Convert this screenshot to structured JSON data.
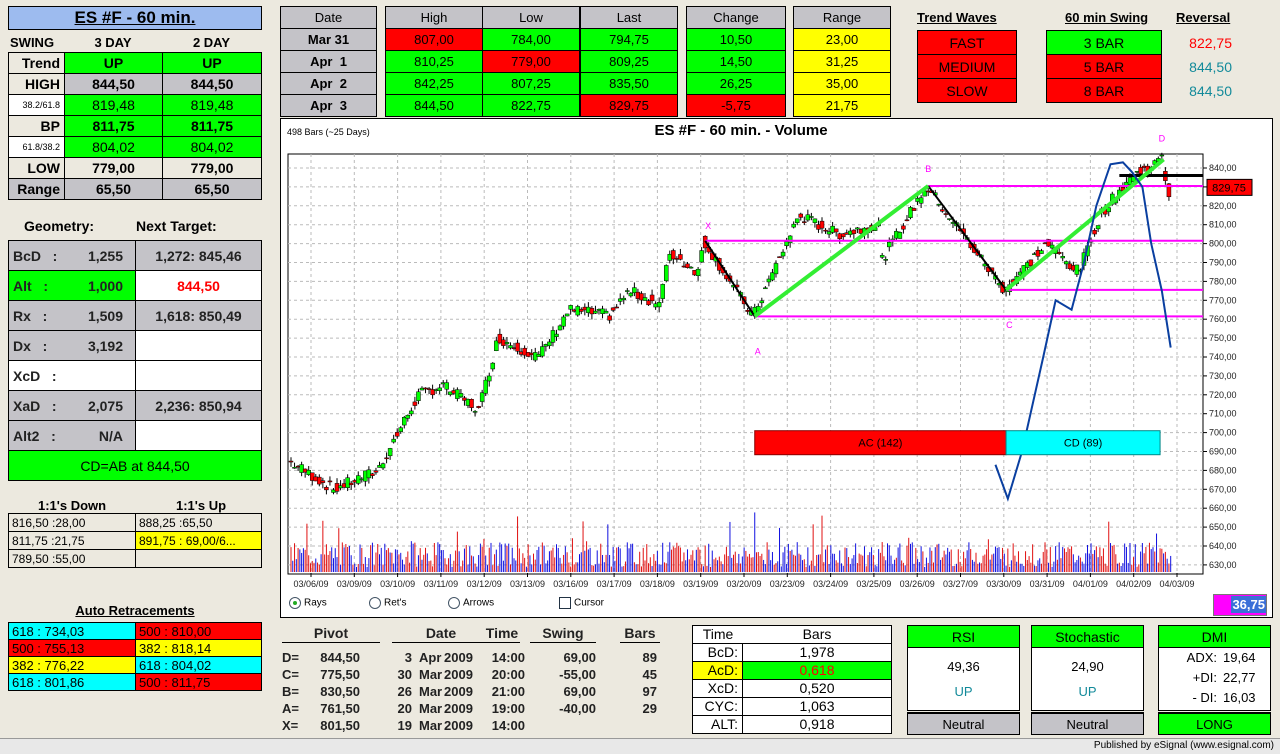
{
  "title": "ES #F - 60 min.",
  "swing": {
    "label": "SWING",
    "col1": "3 DAY",
    "col2": "2 DAY",
    "rows": [
      {
        "label": "Trend",
        "v1": "UP",
        "v2": "UP",
        "cls": "g",
        "lcls": "bg",
        "bold": true
      },
      {
        "label": "HIGH",
        "v1": "844,50",
        "v2": "844,50",
        "cls": "gr",
        "lcls": "bg",
        "bold": true
      },
      {
        "label": "38.2/61.8",
        "v1": "819,48",
        "v2": "819,48",
        "cls": "g",
        "lcls": "w",
        "small": true
      },
      {
        "label": "BP",
        "v1": "811,75",
        "v2": "811,75",
        "cls": "g",
        "lcls": "bg",
        "bold": true
      },
      {
        "label": "61.8/38.2",
        "v1": "804,02",
        "v2": "804,02",
        "cls": "g",
        "lcls": "w",
        "small": true
      },
      {
        "label": "LOW",
        "v1": "779,00",
        "v2": "779,00",
        "cls": "bg",
        "lcls": "bg",
        "bold": true
      },
      {
        "label": "Range",
        "v1": "65,50",
        "v2": "65,50",
        "cls": "gr",
        "lcls": "gr",
        "bold": true
      }
    ]
  },
  "geometry": {
    "h1": "Geometry:",
    "h2": "Next Target:",
    "rows": [
      {
        "label": "BcD",
        "val": "1,255",
        "target": "1,272: 845,46",
        "cls": "gr",
        "tcls": "gr"
      },
      {
        "label": "Alt",
        "val": "1,000",
        "target": "844,50",
        "cls": "g",
        "tcls": "w",
        "tred": true
      },
      {
        "label": "Rx",
        "val": "1,509",
        "target": "1,618: 850,49",
        "cls": "gr",
        "tcls": "gr"
      },
      {
        "label": "Dx",
        "val": "3,192",
        "target": "",
        "cls": "gr",
        "tcls": "w"
      },
      {
        "label": "XcD",
        "val": "",
        "target": "",
        "cls": "w",
        "tcls": "w"
      },
      {
        "label": "XaD",
        "val": "2,075",
        "target": "2,236: 850,94",
        "cls": "gr",
        "tcls": "gr"
      },
      {
        "label": "Alt2",
        "val": "N/A",
        "target": "",
        "cls": "gr",
        "tcls": "w"
      }
    ],
    "summary": "CD=AB at 844,50"
  },
  "ones": {
    "down_label": "1:1's Down",
    "up_label": "1:1's Up",
    "rows": [
      {
        "d": "816,50 :28,00",
        "u": "888,25 :65,50",
        "ucls": "bg"
      },
      {
        "d": "811,75 :21,75",
        "u": "891,75 : 69,00/6...",
        "ucls": "y"
      },
      {
        "d": "789,50 :55,00",
        "u": "",
        "ucls": "bg"
      }
    ]
  },
  "retr": {
    "label": "Auto Retracements",
    "rows": [
      {
        "l": "618 : 734,03",
        "lc": "cy",
        "r": "500 : 810,00",
        "rc": "r"
      },
      {
        "l": "500 : 755,13",
        "lc": "r",
        "r": "382 : 818,14",
        "rc": "y"
      },
      {
        "l": "382 : 776,22",
        "lc": "y",
        "r": "618 : 804,02",
        "rc": "cy"
      },
      {
        "l": "618 : 801,86",
        "lc": "cy",
        "r": "500 : 811,75",
        "rc": "r"
      }
    ]
  },
  "quotes": {
    "headers": [
      "Date",
      "High",
      "Low",
      "Last",
      "Change",
      "Range"
    ],
    "rows": [
      {
        "date": "Mar 31",
        "high": "807,00",
        "low": "784,00",
        "last": "794,75",
        "change": "10,50",
        "range": "23,00",
        "c": [
          "r",
          "g",
          "g",
          "g",
          "y"
        ]
      },
      {
        "date": "Apr  1",
        "high": "810,25",
        "low": "779,00",
        "last": "809,25",
        "change": "14,50",
        "range": "31,25",
        "c": [
          "g",
          "r",
          "g",
          "g",
          "y"
        ]
      },
      {
        "date": "Apr  2",
        "high": "842,25",
        "low": "807,25",
        "last": "835,50",
        "change": "26,25",
        "range": "35,00",
        "c": [
          "g",
          "g",
          "g",
          "g",
          "y"
        ]
      },
      {
        "date": "Apr  3",
        "high": "844,50",
        "low": "822,75",
        "last": "829,75",
        "change": "-5,75",
        "range": "21,75",
        "c": [
          "g",
          "g",
          "r",
          "r",
          "y"
        ]
      }
    ]
  },
  "trend": {
    "h1": "Trend Waves",
    "h2": "60 min Swing",
    "h3": "Reversal",
    "rows": [
      {
        "wave": "FAST",
        "swing": "3 BAR",
        "rev": "822,75",
        "sc": "g",
        "revc": "#ff0000"
      },
      {
        "wave": "MEDIUM",
        "swing": "5 BAR",
        "rev": "844,50",
        "sc": "r",
        "revc": "#128a9a"
      },
      {
        "wave": "SLOW",
        "swing": "8 BAR",
        "rev": "844,50",
        "sc": "r",
        "revc": "#128a9a"
      }
    ]
  },
  "chart_data": {
    "type": "candlestick",
    "title": "ES #F - 60 min. - Volume",
    "bars_label": "498 Bars (~25 Days)",
    "bars": 498,
    "ylim": [
      630,
      840
    ],
    "yticks": [
      "630,00",
      "640,00",
      "650,00",
      "660,00",
      "670,00",
      "680,00",
      "690,00",
      "700,00",
      "710,00",
      "720,00",
      "730,00",
      "740,00",
      "750,00",
      "760,00",
      "770,00",
      "780,00",
      "790,00",
      "800,00",
      "810,00",
      "820,00",
      "830,00",
      "840,00"
    ],
    "xticks": [
      "03/06/09",
      "03/09/09",
      "03/10/09",
      "03/11/09",
      "03/12/09",
      "03/13/09",
      "03/16/09",
      "03/17/09",
      "03/18/09",
      "03/19/09",
      "03/20/09",
      "03/23/09",
      "03/24/09",
      "03/25/09",
      "03/26/09",
      "03/27/09",
      "03/30/09",
      "03/31/09",
      "04/01/09",
      "04/02/09",
      "04/03/09"
    ],
    "path": [
      [
        0,
        685
      ],
      [
        25,
        670
      ],
      [
        50,
        680
      ],
      [
        73,
        720
      ],
      [
        87,
        725
      ],
      [
        107,
        712
      ],
      [
        118,
        750
      ],
      [
        141,
        740
      ],
      [
        158,
        765
      ],
      [
        181,
        762
      ],
      [
        192,
        775
      ],
      [
        209,
        768
      ],
      [
        215,
        795
      ],
      [
        231,
        785
      ],
      [
        234,
        801.5
      ],
      [
        262,
        761.5
      ],
      [
        288,
        815
      ],
      [
        310,
        805
      ],
      [
        333,
        810
      ],
      [
        334,
        790
      ],
      [
        360,
        830.5
      ],
      [
        404,
        775.5
      ],
      [
        428,
        800
      ],
      [
        446,
        785
      ],
      [
        458,
        815
      ],
      [
        475,
        835
      ],
      [
        493,
        844.5
      ],
      [
        497,
        826
      ]
    ],
    "last_price": "829,75",
    "last_value": 829.75,
    "levels": [
      {
        "price": 801.5,
        "from": 234
      },
      {
        "price": 761.5,
        "from": 262
      },
      {
        "price": 830.5,
        "from": 360
      },
      {
        "price": 775.5,
        "from": 404
      },
      {
        "price": 844.5,
        "from": 493
      }
    ],
    "resistance": {
      "price": 836,
      "from": 468
    },
    "pivots": [
      {
        "name": "X",
        "bar": 234,
        "price": 801.5
      },
      {
        "name": "A",
        "bar": 262,
        "price": 761.5
      },
      {
        "name": "B",
        "bar": 360,
        "price": 830.5
      },
      {
        "name": "C",
        "bar": 404,
        "price": 775.5
      },
      {
        "name": "D",
        "bar": 493,
        "price": 844.5
      }
    ],
    "oscillator": [
      [
        398,
        683
      ],
      [
        405,
        665
      ],
      [
        413,
        690
      ],
      [
        425,
        740
      ],
      [
        432,
        770
      ],
      [
        441,
        765
      ],
      [
        448,
        790
      ],
      [
        455,
        820
      ],
      [
        463,
        842
      ],
      [
        470,
        843
      ],
      [
        475,
        838
      ],
      [
        481,
        830
      ],
      [
        486,
        800
      ],
      [
        492,
        775
      ],
      [
        497,
        745
      ]
    ],
    "ac_label": "AC (142)",
    "cd_label": "CD (89)",
    "ac_bars": 142,
    "cd_bars": 89,
    "readout": "36,75"
  },
  "controls": {
    "rays": "Rays",
    "rets": "Ret's",
    "arrows": "Arrows",
    "cursor": "Cursor"
  },
  "pivots": {
    "headers": [
      "Pivot",
      "Date",
      "Time",
      "Swing",
      "Bars"
    ],
    "rows": [
      [
        "D=",
        "844,50",
        "3",
        "Apr",
        "2009",
        "14:00",
        "69,00",
        "89"
      ],
      [
        "C=",
        "775,50",
        "30",
        "Mar",
        "2009",
        "20:00",
        "-55,00",
        "45"
      ],
      [
        "B=",
        "830,50",
        "26",
        "Mar",
        "2009",
        "21:00",
        "69,00",
        "97"
      ],
      [
        "A=",
        "761,50",
        "20",
        "Mar",
        "2009",
        "19:00",
        "-40,00",
        "29"
      ],
      [
        "X=",
        "801,50",
        "19",
        "Mar",
        "2009",
        "14:00",
        "",
        ""
      ]
    ]
  },
  "timebars": {
    "h1": "Time",
    "h2": "Bars",
    "rows": [
      [
        "BcD:",
        "1,978"
      ],
      [
        "AcD:",
        "0,618"
      ],
      [
        "XcD:",
        "0,520"
      ],
      [
        "CYC:",
        "1,063"
      ],
      [
        "ALT:",
        "0,918"
      ]
    ]
  },
  "rsi": {
    "title": "RSI",
    "value": "49,36",
    "dir": "UP",
    "status": "Neutral"
  },
  "stoch": {
    "title": "Stochastic",
    "value": "24,90",
    "dir": "UP",
    "status": "Neutral"
  },
  "dmi": {
    "title": "DMI",
    "adx_l": "ADX:",
    "adx": "19,64",
    "pdi_l": "+DI:",
    "pdi": "22,77",
    "mdi_l": "- DI:",
    "mdi": "16,03",
    "status": "LONG"
  },
  "footer": "Published by eSignal (www.esignal.com)"
}
